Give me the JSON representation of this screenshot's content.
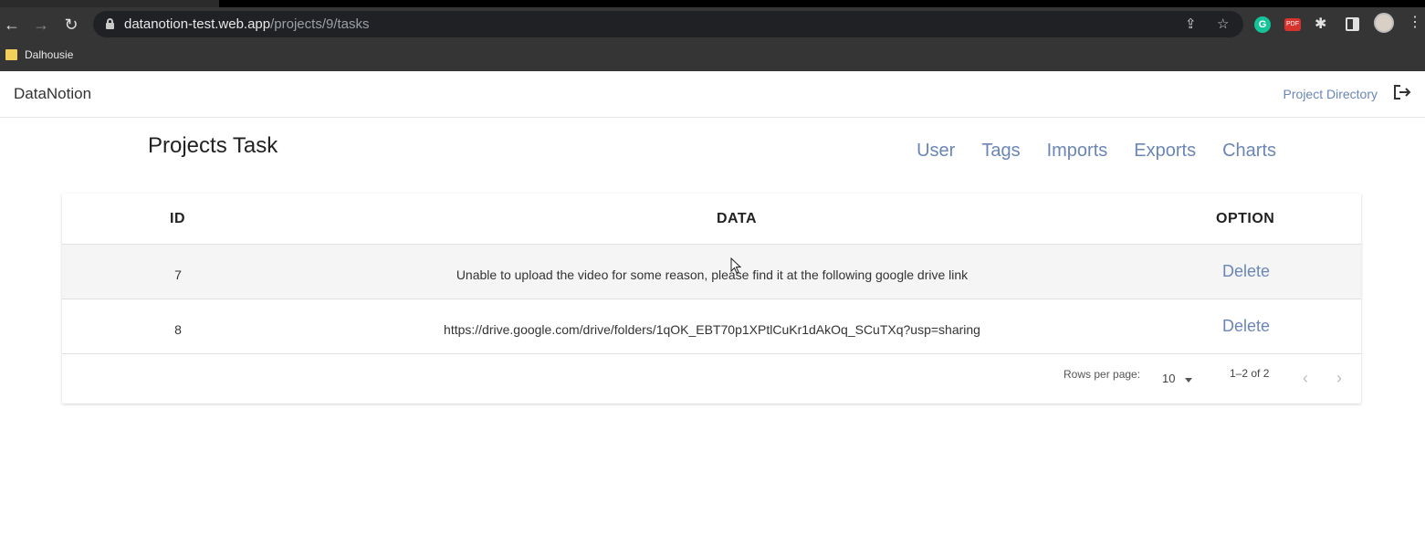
{
  "browser": {
    "url_domain": "datanotion-test.web.app",
    "url_path": "/projects/9/tasks",
    "bookmark": "Dalhousie",
    "extension_red_text": "PDF"
  },
  "app": {
    "brand": "DataNotion",
    "project_directory": "Project Directory"
  },
  "page": {
    "title": "Projects Task",
    "tabs": [
      "User",
      "Tags",
      "Imports",
      "Exports",
      "Charts"
    ]
  },
  "table": {
    "headers": {
      "id": "ID",
      "data": "DATA",
      "option": "OPTION"
    },
    "rows": [
      {
        "id": "7",
        "data": "Unable to upload the video for some reason, please find it at the following google drive link",
        "option": "Delete"
      },
      {
        "id": "8",
        "data": "https://drive.google.com/drive/folders/1qOK_EBT70p1XPtlCuKr1dAkOq_SCuTXq?usp=sharing",
        "option": "Delete"
      }
    ],
    "pagination": {
      "rows_per_page_label": "Rows per page:",
      "rows_per_page_value": "10",
      "range": "1–2 of 2"
    }
  },
  "colors": {
    "accent": "#6a86b8",
    "chrome": "#353535"
  }
}
